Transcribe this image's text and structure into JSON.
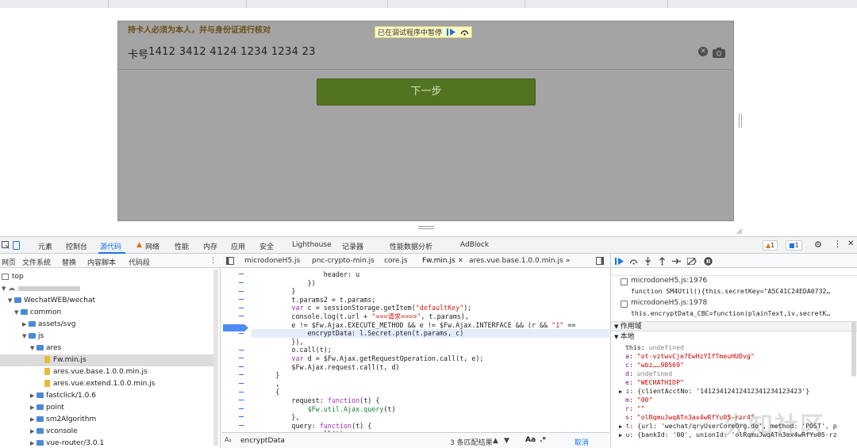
{
  "page": {
    "warning_text": "持卡人必须为本人，并与身份证进行核对",
    "card_label": "卡号",
    "card_number": "1412 3412 4124 1234 1234 23",
    "next_button": "下一步",
    "paused_banner": "已在调试程序中暂停"
  },
  "devtools": {
    "tabs": [
      "元素",
      "控制台",
      "源代码",
      "网络",
      "性能",
      "内存",
      "应用",
      "安全",
      "Lighthouse",
      "记录器",
      "性能数据分析",
      "AdBlock"
    ],
    "warning_count": "1",
    "info_count": "1"
  },
  "navigator": {
    "tabs": [
      "网页",
      "文件系统",
      "替换",
      "内容脚本",
      "代码段"
    ],
    "tree": [
      {
        "label": "top",
        "kind": "frame"
      },
      {
        "label": "",
        "kind": "cloud"
      },
      {
        "label": "WechatWEB/wechat",
        "kind": "folder"
      },
      {
        "label": "common",
        "kind": "folder"
      },
      {
        "label": "assets/svg",
        "kind": "folder"
      },
      {
        "label": "js",
        "kind": "folder"
      },
      {
        "label": "ares",
        "kind": "folder"
      },
      {
        "label": "Fw.min.js",
        "kind": "file"
      },
      {
        "label": "ares.vue.base.1.0.0.min.js",
        "kind": "file"
      },
      {
        "label": "ares.vue.extend.1.0.0.min.js",
        "kind": "file"
      },
      {
        "label": "fastclick/1.0.6",
        "kind": "folder"
      },
      {
        "label": "point",
        "kind": "folder"
      },
      {
        "label": "sm2Algorithm",
        "kind": "folder"
      },
      {
        "label": "vconsole",
        "kind": "folder"
      },
      {
        "label": "vue-router/3.0.1",
        "kind": "folder"
      }
    ]
  },
  "editor": {
    "tabs": [
      "microdoneH5.js",
      "pnc-crypto-min.js",
      "core.js",
      "Fw.min.js",
      "ares.vue.base.1.0.0.min.js"
    ],
    "more": "»",
    "search_value": "encryptData",
    "match_count": "3 条匹配结果",
    "case_btn": "Aa",
    "regex_btn": ".*",
    "cancel": "取消"
  },
  "debugger": {
    "breakpoints": [
      {
        "file": "microdoneH5.js:1976",
        "code": "function SM4Util(){this.secretKey=\"A5C41C24EDA0732…"
      },
      {
        "file": "microdoneH5.js:1978",
        "code": "this.encryptData_CBC=function(plainText,iv,secretK…"
      }
    ],
    "scope_header": "作用域",
    "local_header": "本地",
    "scope": [
      {
        "name": "this",
        "value": "undefined",
        "kind": "undef"
      },
      {
        "name": "a",
        "value": "\"ot-vztwvCje7EwHzYIfTmeuHUDvg\"",
        "kind": "str"
      },
      {
        "name": "c",
        "value": "\"wbz……98569\"",
        "kind": "str"
      },
      {
        "name": "d",
        "value": "undefined",
        "kind": "undef"
      },
      {
        "name": "e",
        "value": "\"WECHATHIDP\"",
        "kind": "str"
      },
      {
        "name": "i",
        "value": "{clientAcctNo: '14123412412412341234123423'}",
        "kind": "obj"
      },
      {
        "name": "m",
        "value": "\"00\"",
        "kind": "str"
      },
      {
        "name": "r",
        "value": "\"\"",
        "kind": "str"
      },
      {
        "name": "s",
        "value": "\"olRqmuJwqATn3ax4wRfYu05-rzr4\"",
        "kind": "str"
      },
      {
        "name": "t",
        "value": "{url: 'wechat/qryUserCoreOrg.do', method: 'POST', p",
        "kind": "obj"
      },
      {
        "name": "u",
        "value": "{bankId: '00', unionId: 'olRqmuJwqATn3ax4wRfYu05-rz",
        "kind": "obj"
      }
    ],
    "watermark": "先知社区"
  }
}
